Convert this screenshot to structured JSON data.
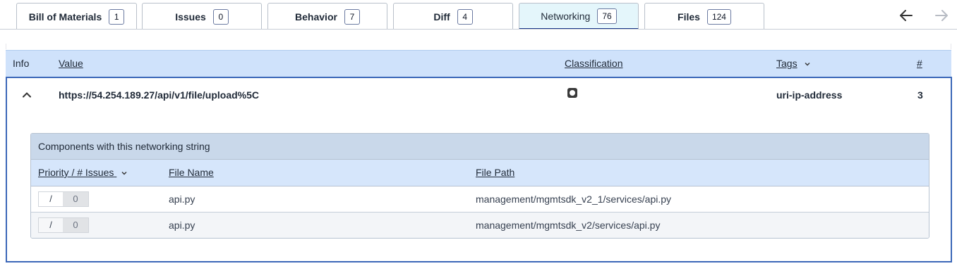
{
  "tabs": [
    {
      "label": "Bill of Materials",
      "count": "1",
      "active": false
    },
    {
      "label": "Issues",
      "count": "0",
      "active": false
    },
    {
      "label": "Behavior",
      "count": "7",
      "active": false
    },
    {
      "label": "Diff",
      "count": "4",
      "active": false
    },
    {
      "label": "Networking",
      "count": "76",
      "active": true
    },
    {
      "label": "Files",
      "count": "124",
      "active": false
    }
  ],
  "nav": {
    "back_icon": "arrow-left-icon",
    "forward_icon": "arrow-right-icon"
  },
  "grid": {
    "headers": {
      "info": "Info",
      "value": "Value",
      "classification": "Classification",
      "tags": "Tags",
      "count": "#"
    },
    "row": {
      "value": "https://54.254.189.27/api/v1/file/upload%5C",
      "classification_icon": "record-icon",
      "tag": "uri-ip-address",
      "count": "3"
    }
  },
  "components": {
    "title": "Components with this networking string",
    "headers": {
      "priority": "Priority / # Issues",
      "file_name": "File Name",
      "file_path": "File Path"
    },
    "rows": [
      {
        "priority": "/",
        "issues": "0",
        "file_name": "api.py",
        "file_path": "management/mgmtsdk_v2_1/services/api.py"
      },
      {
        "priority": "/",
        "issues": "0",
        "file_name": "api.py",
        "file_path": "management/mgmtsdk_v2/services/api.py"
      }
    ]
  },
  "colors": {
    "accent": "#3b67b8",
    "header_bg": "#cfe2fb",
    "active_tab_bg": "#e4f6fb"
  }
}
